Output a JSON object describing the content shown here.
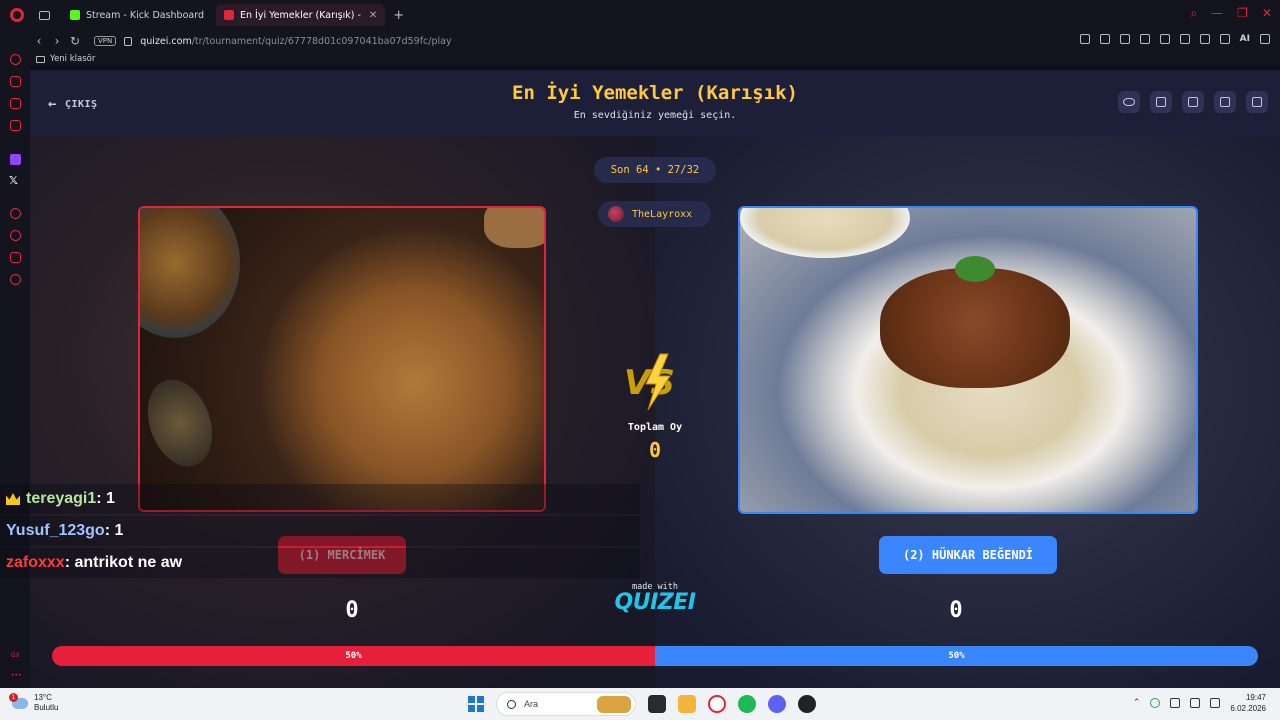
{
  "browser": {
    "tabs": [
      {
        "label": "Stream - Kick Dashboard",
        "active": false
      },
      {
        "label": "En İyi Yemekler (Karışık) -",
        "active": true
      }
    ],
    "url_host": "quizei.com",
    "url_path": "/tr/tournament/quiz/67778d01c097041ba07d59fc/play",
    "vpn_label": "VPN",
    "bookmark_folder": "Yeni klasör",
    "ai_label": "AI",
    "sidebar_text": "GX"
  },
  "page": {
    "back_label": "ÇIKIŞ",
    "title": "En İyi Yemekler (Karışık)",
    "subtitle": "En sevdiğiniz yemeği seçin.",
    "header_icons": [
      "eye-icon",
      "copy-icon",
      "send-icon",
      "flag-icon",
      "fullscreen-icon"
    ],
    "round_label": "Son 64 • 27/32",
    "username": "TheLayroxx",
    "total_label": "Toplam Oy",
    "total_value": "0",
    "made_with": "made with",
    "brand": "QUIZEI",
    "options": [
      {
        "label": "(1) MERCİMEK",
        "score": "0",
        "percent_label": "50%",
        "percent": 50,
        "color": "#e61f3a"
      },
      {
        "label": "(2) HÜNKAR BEĞENDİ",
        "score": "0",
        "percent_label": "50%",
        "percent": 50,
        "color": "#3a86ff"
      }
    ]
  },
  "chat": [
    {
      "user": "tereyagi1",
      "message": " : 1",
      "badge": "crown-icon"
    },
    {
      "user": "Yusuf_123go",
      "message": " : 1"
    },
    {
      "user": "zafoxxx",
      "message": " : antrikot ne aw"
    }
  ],
  "taskbar": {
    "weather_temp": "13°C",
    "weather_desc": "Bulutlu",
    "notification_count": "1",
    "search_placeholder": "Ara",
    "time": "19:47",
    "date": "6.02.2026"
  }
}
